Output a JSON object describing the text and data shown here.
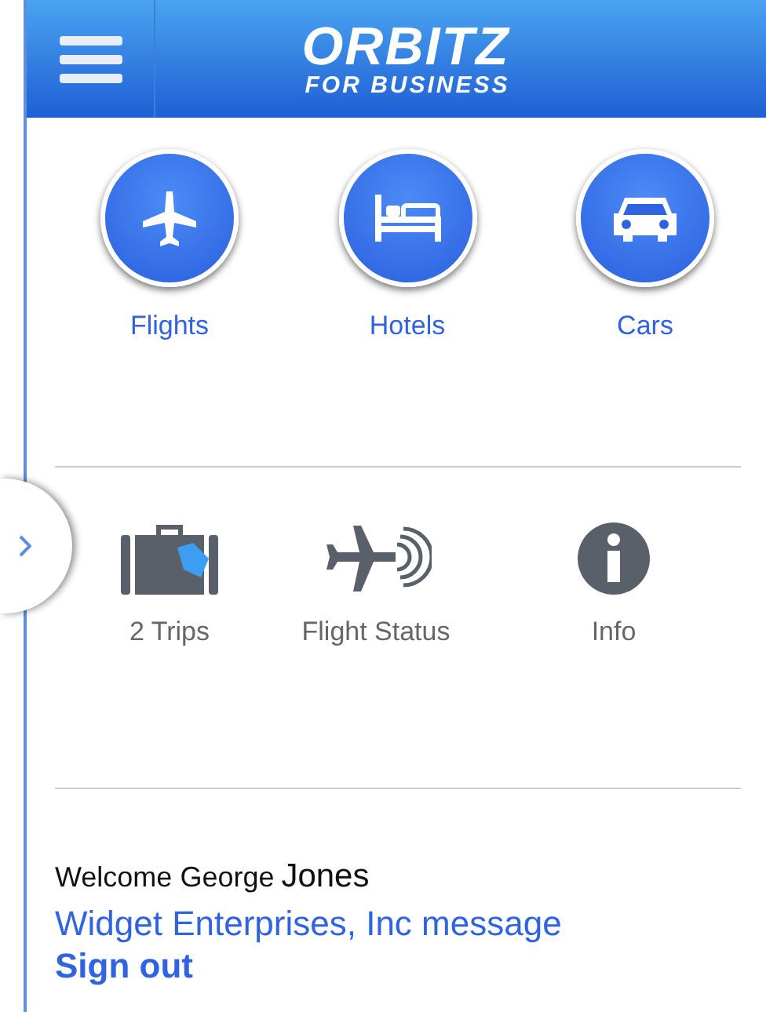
{
  "header": {
    "logo": {
      "name": "ORBITZ",
      "tagline": "FOR BUSINESS"
    }
  },
  "booking": [
    {
      "label": "Flights",
      "kind": "plane"
    },
    {
      "label": "Hotels",
      "kind": "bed"
    },
    {
      "label": "Cars",
      "kind": "car"
    }
  ],
  "tools": [
    {
      "label": "2 Trips",
      "kind": "suitcase"
    },
    {
      "label": "Flight Status",
      "kind": "flight-status"
    },
    {
      "label": "Info",
      "kind": "info"
    }
  ],
  "welcome": {
    "greeting": "Welcome George",
    "surname": "Jones"
  },
  "company_message": "Widget Enterprises, Inc message",
  "sign_out": "Sign out"
}
